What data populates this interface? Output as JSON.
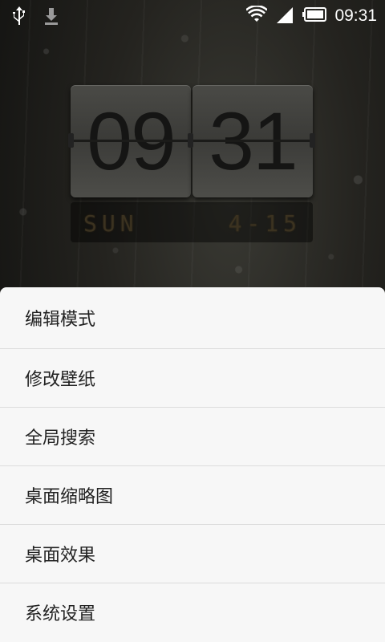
{
  "status_bar": {
    "icons_left": [
      "usb-icon",
      "download-icon"
    ],
    "icons_right": [
      "wifi-icon",
      "signal-icon",
      "battery-icon"
    ],
    "time": "09:31"
  },
  "clock_widget": {
    "hours": "09",
    "minutes": "31",
    "day": "SUN",
    "date": "4-15"
  },
  "menu": {
    "items": [
      {
        "label": "编辑模式"
      },
      {
        "label": "修改壁纸"
      },
      {
        "label": "全局搜索"
      },
      {
        "label": "桌面缩略图"
      },
      {
        "label": "桌面效果"
      },
      {
        "label": "系统设置"
      }
    ]
  }
}
